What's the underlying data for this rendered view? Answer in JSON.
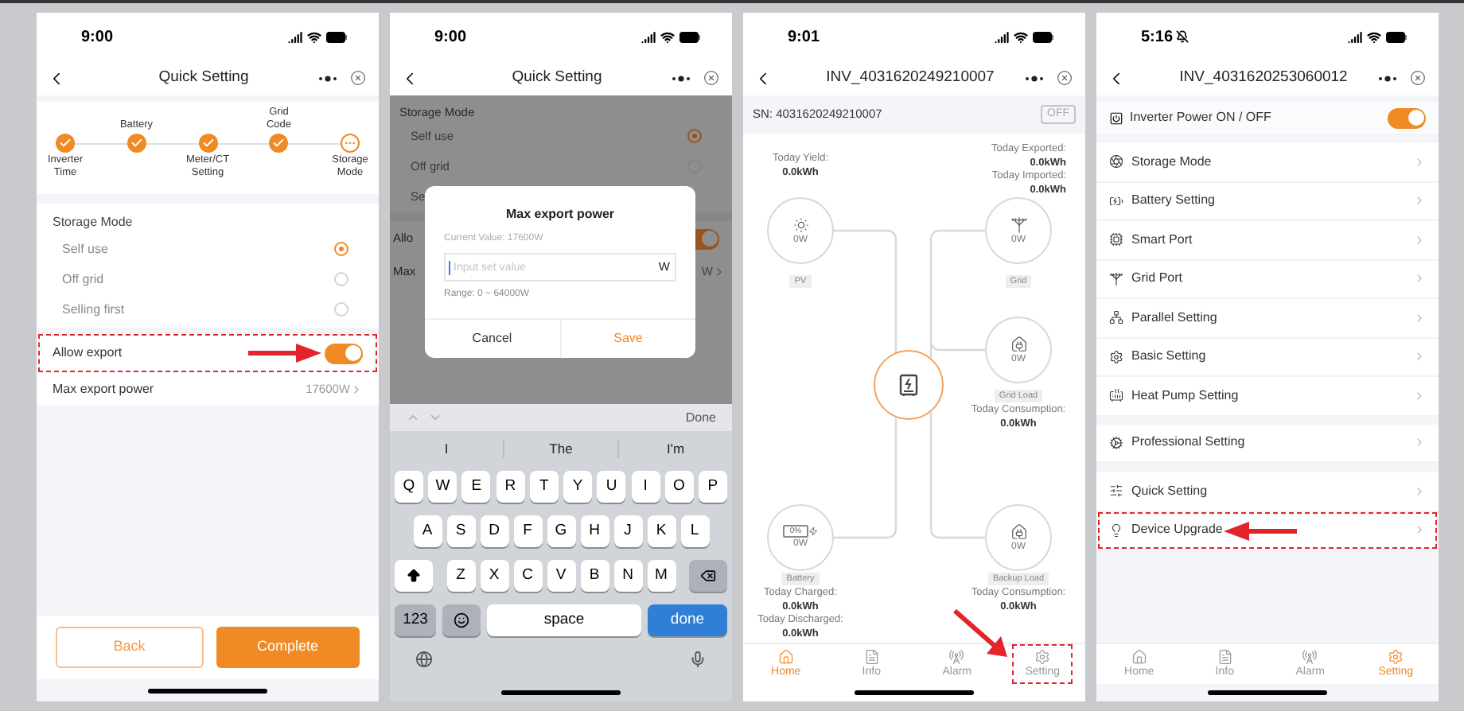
{
  "quick_setting": {
    "status": {
      "time": "9:00"
    },
    "title": "Quick Setting",
    "steps": [
      {
        "label": "Inverter Time",
        "done": true
      },
      {
        "label": "Battery",
        "done": true
      },
      {
        "label": "Meter/CT Setting",
        "done": true
      },
      {
        "label": "Grid Code",
        "done": true
      },
      {
        "label": "Storage Mode",
        "done": false
      }
    ],
    "section_title": "Storage Mode",
    "modes": [
      {
        "label": "Self use",
        "selected": true
      },
      {
        "label": "Off grid",
        "selected": false
      },
      {
        "label": "Selling first",
        "selected": false
      }
    ],
    "allow_export": {
      "label": "Allow export",
      "on": true,
      "highlighted": true
    },
    "max_export": {
      "label": "Max export power",
      "value": "17600W"
    },
    "buttons": {
      "back": "Back",
      "complete": "Complete"
    }
  },
  "export_dialog": {
    "status": {
      "time": "9:00"
    },
    "title": "Quick Setting",
    "background": {
      "section_title": "Storage Mode",
      "modes": [
        {
          "label": "Self use",
          "selected": true
        },
        {
          "label": "Off grid",
          "selected": false
        }
      ],
      "cut_mode_label": "Se",
      "allow_label": "Allo",
      "allow_on": true,
      "max_label": "Max",
      "max_value": "W"
    },
    "dialog": {
      "title": "Max export power",
      "current_value": "Current Value: 17600W",
      "placeholder": "Input set value",
      "unit": "W",
      "range": "Range: 0 ~ 64000W",
      "cancel": "Cancel",
      "save": "Save"
    },
    "keyboard": {
      "toolbar_done": "Done",
      "suggestions": [
        "I",
        "The",
        "I'm"
      ],
      "rows": [
        [
          "Q",
          "W",
          "E",
          "R",
          "T",
          "Y",
          "U",
          "I",
          "O",
          "P"
        ],
        [
          "A",
          "S",
          "D",
          "F",
          "G",
          "H",
          "J",
          "K",
          "L"
        ],
        [
          "Z",
          "X",
          "C",
          "V",
          "B",
          "N",
          "M"
        ]
      ],
      "numbers_key": "123",
      "space_key": "space",
      "return_key": "done"
    }
  },
  "energy_flow": {
    "status": {
      "time": "9:01"
    },
    "title": "INV_4031620249210007",
    "sn": "SN: 4031620249210007",
    "power_badge": "OFF",
    "nodes": [
      {
        "kind": "pv",
        "name": "PV",
        "power": "0W",
        "stats": [
          {
            "label": "Today Yield:",
            "value": "0.0kWh"
          }
        ]
      },
      {
        "kind": "grid",
        "name": "Grid",
        "power": "0W",
        "stats": [
          {
            "label": "Today Exported:",
            "value": "0.0kWh"
          },
          {
            "label": "Today Imported:",
            "value": "0.0kWh"
          }
        ]
      },
      {
        "kind": "grid_load",
        "name": "Grid Load",
        "power": "0W",
        "stats": [
          {
            "label": "Today Consumption:",
            "value": "0.0kWh"
          }
        ]
      },
      {
        "kind": "battery",
        "name": "Battery",
        "power": "0W",
        "charge": "0%",
        "stats": [
          {
            "label": "Today Charged:",
            "value": "0.0kWh"
          },
          {
            "label": "Today Discharged:",
            "value": "0.0kWh"
          }
        ]
      },
      {
        "kind": "backup_load",
        "name": "Backup Load",
        "power": "0W",
        "stats": [
          {
            "label": "Today Consumption:",
            "value": "0.0kWh"
          }
        ]
      }
    ],
    "tabs": [
      {
        "label": "Home",
        "selected": true,
        "highlighted": false
      },
      {
        "label": "Info",
        "selected": false,
        "highlighted": false
      },
      {
        "label": "Alarm",
        "selected": false,
        "highlighted": false
      },
      {
        "label": "Setting",
        "selected": false,
        "highlighted": true
      }
    ]
  },
  "settings": {
    "status": {
      "time": "5:16",
      "silent": true
    },
    "title": "INV_4031620253060012",
    "power_row": {
      "label": "Inverter Power ON / OFF",
      "on": true
    },
    "groups": [
      [
        {
          "label": "Storage Mode",
          "highlighted": false
        },
        {
          "label": "Battery Setting",
          "highlighted": false
        },
        {
          "label": "Smart Port",
          "highlighted": false
        },
        {
          "label": "Grid Port",
          "highlighted": false
        },
        {
          "label": "Parallel Setting",
          "highlighted": false
        },
        {
          "label": "Basic Setting",
          "highlighted": false
        },
        {
          "label": "Heat Pump Setting",
          "highlighted": false
        }
      ],
      [
        {
          "label": "Professional Setting",
          "highlighted": false
        }
      ],
      [
        {
          "label": "Quick Setting",
          "highlighted": false
        },
        {
          "label": "Device Upgrade",
          "highlighted": true
        }
      ]
    ],
    "tabs": [
      {
        "label": "Home",
        "selected": false,
        "highlighted": false
      },
      {
        "label": "Info",
        "selected": false,
        "highlighted": false
      },
      {
        "label": "Alarm",
        "selected": false,
        "highlighted": false
      },
      {
        "label": "Setting",
        "selected": true,
        "highlighted": false
      }
    ]
  }
}
